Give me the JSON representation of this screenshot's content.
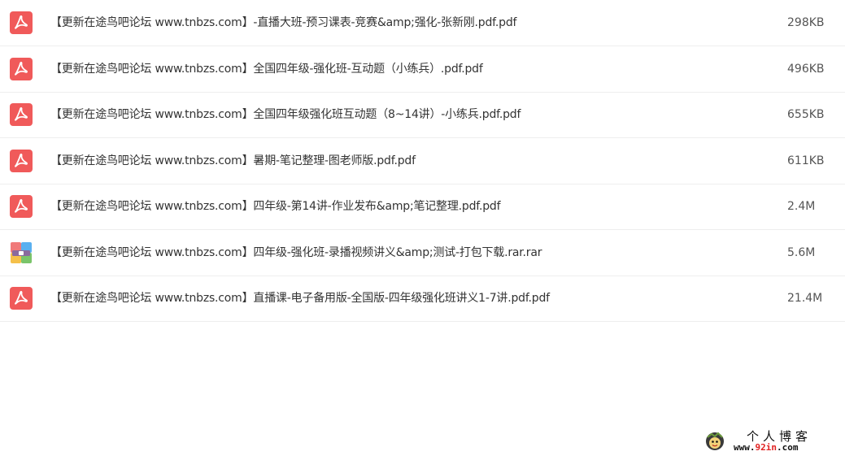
{
  "files": [
    {
      "icon": "pdf-icon",
      "name": "【更新在途鸟吧论坛 www.tnbzs.com】-直播大班-预习课表-竞赛&amp;强化-张新刚.pdf.pdf",
      "size": "298KB"
    },
    {
      "icon": "pdf-icon",
      "name": "【更新在途鸟吧论坛 www.tnbzs.com】全国四年级-强化班-互动题（小练兵）.pdf.pdf",
      "size": "496KB"
    },
    {
      "icon": "pdf-icon",
      "name": "【更新在途鸟吧论坛 www.tnbzs.com】全国四年级强化班互动题（8~14讲）-小练兵.pdf.pdf",
      "size": "655KB"
    },
    {
      "icon": "pdf-icon",
      "name": "【更新在途鸟吧论坛 www.tnbzs.com】暑期-笔记整理-图老师版.pdf.pdf",
      "size": "611KB"
    },
    {
      "icon": "pdf-icon",
      "name": "【更新在途鸟吧论坛 www.tnbzs.com】四年级-第14讲-作业发布&amp;笔记整理.pdf.pdf",
      "size": "2.4M"
    },
    {
      "icon": "rar-icon",
      "name": "【更新在途鸟吧论坛 www.tnbzs.com】四年级-强化班-录播视频讲义&amp;测试-打包下载.rar.rar",
      "size": "5.6M"
    },
    {
      "icon": "pdf-icon",
      "name": "【更新在途鸟吧论坛 www.tnbzs.com】直播课-电子备用版-全国版-四年级强化班讲义1-7讲.pdf.pdf",
      "size": "21.4M"
    }
  ],
  "watermark": {
    "title": "个人博客",
    "url_prefix": "www.",
    "url_highlight": "92in",
    "url_suffix": ".com"
  },
  "colors": {
    "pdf_icon": "#f05a5a",
    "row_divider": "#eeeeee",
    "text": "#333333",
    "watermark_highlight": "#e02020"
  }
}
